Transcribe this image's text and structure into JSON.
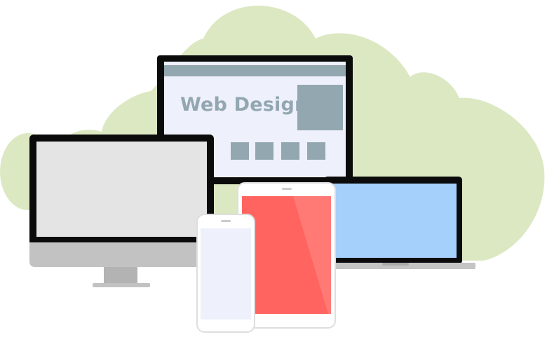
{
  "illustration": {
    "headline": "Web Design",
    "devices": [
      "desktop-monitor",
      "web-design-monitor",
      "laptop",
      "tablet",
      "smartphone"
    ],
    "colors": {
      "cloud": "#dce8c2",
      "bezel": "#0b0b0b",
      "web_screen": "#eef0fb",
      "web_accent": "#93a7b1",
      "desktop_screen": "#e4e4e4",
      "stand": "#c2c2c2",
      "laptop_screen": "#a5d0fb",
      "tablet_screen": "#ff6460",
      "phone_screen": "#eef0fb",
      "device_body": "#ffffff"
    }
  }
}
